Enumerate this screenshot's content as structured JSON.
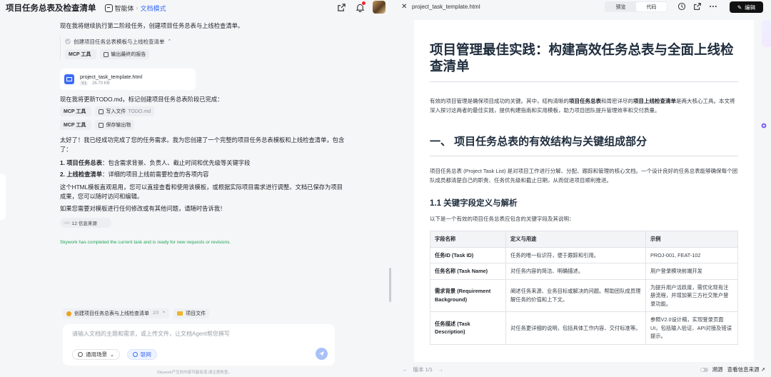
{
  "header": {
    "title": "项目任务总表及检查清单",
    "agent": "智能体",
    "mode": "文档模式"
  },
  "chat": {
    "intro": "现在我将继续执行第二阶段任务，创建项目任务总表与上线检查清单。",
    "tool_group_title": "创建项目任务总表模板与上线检查清单",
    "tool_chip_label": "MCP 工具",
    "tool_chip_action": "输出最终的报告",
    "file": {
      "name": "project_task_template.html",
      "version": "V1",
      "size": "26.70 KB"
    },
    "todo_msg": "现在我将更新TODO.md，标记创建项目任务总表阶段已完成：",
    "write_label": "MCP 工具",
    "write_action": "写入文件",
    "write_target": "TODO.md",
    "save_label": "MCP 工具",
    "save_action": "保存输出物",
    "done_msg": "太好了！我已经成功完成了您的任务需求。我为您创建了一个完整的项目任务总表模板和上线检查清单，包含了：",
    "list": [
      {
        "num": "1.",
        "bold": "项目任务总表",
        "text": "：包含需求背景、负责人、截止时间和优先级等关键字段"
      },
      {
        "num": "2.",
        "bold": "上线检查清单",
        "text": "：详细的项目上线前需要检查的各项内容"
      }
    ],
    "explain": "这个HTML模板直观易用，您可以直接查看和使用该模板，或根据实际项目需求进行调整。文档已保存为项目成果，您可以随时访问和编辑。",
    "followup": "如果您需要对模板进行任何修改或有其他问题，请随时告诉我！",
    "sources": "12 信息来源",
    "status": "Skywork has completed the current task and is ready for new requests or revisions."
  },
  "composer": {
    "task_tab": "创建项目任务总表与上线检查清单",
    "task_count": "2/3",
    "files_tab": "项目文件",
    "placeholder": "请输入文档的主题和需求，或上传文件，让文档Agent帮您撰写",
    "scene_btn": "通用场景",
    "web_btn": "联网",
    "footer": "Skywork产生的内容可能有误,请注意核查。"
  },
  "viewer": {
    "filename": "project_task_template.html",
    "tab_preview": "预览",
    "tab_code": "代码",
    "edit": "编辑",
    "pager": "版本 1/1",
    "source_toggle": "溯源",
    "view_sources": "查看信息来源"
  },
  "doc": {
    "title": "项目管理最佳实践：构建高效任务总表与全面上线检查清单",
    "intro_a": "有效的项目管理是确保项目成功的关键。其中，结构清晰的",
    "intro_b1": "项目任务总表",
    "intro_c": "和周密详尽的",
    "intro_b2": "项目上线检查清单",
    "intro_d": "是两大核心工具。本文将深入探讨这两者的最佳实践，提供构建指南和实用模板，助力项目团队提升管理效率和交付质量。",
    "h2": "一、 项目任务总表的有效结构与关键组成部分",
    "p2": "项目任务总表 (Project Task List) 是对项目工作进行分解、分配、跟踪和管理的核心文档。一个设计良好的任务总表能够确保每个团队成员都清楚自己的职责、任务优先级和截止日期，从而促进项目顺利推进。",
    "h3": "1.1 关键字段定义与解析",
    "p3": "以下是一个有效的项目任务总表应包含的关键字段及其说明：",
    "table_headers": [
      "字段名称",
      "定义与用途",
      "示例"
    ],
    "table_rows": [
      [
        "任务ID (Task ID)",
        "任务的唯一标识符，便于跟踪和引用。",
        "PROJ-001, FEAT-102"
      ],
      [
        "任务名称 (Task Name)",
        "对任务内容的简洁、明确描述。",
        "用户登录模块前端开发"
      ],
      [
        "需求背景 (Requirement Background)",
        "阐述任务来源、业务目标或解决的问题。帮助团队成员理解任务的价值和上下文。",
        "为提升用户活跃度，需优化现有注册流程，并增加第三方社交账户登录功能。"
      ],
      [
        "任务描述 (Task Description)",
        "对任务更详细的说明，包括具体工作内容、交付标准等。",
        "参照V2.0设计稿，实现登录页面UI，包括输入验证、API对接及错误提示。"
      ]
    ]
  }
}
